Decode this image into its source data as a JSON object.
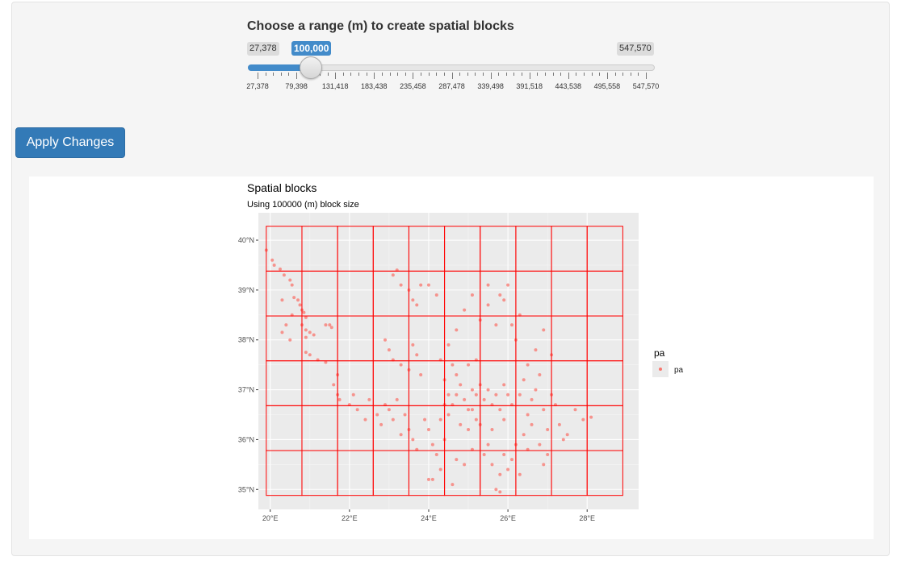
{
  "slider": {
    "label": "Choose a range (m) to create spatial blocks",
    "min_label": "27,378",
    "max_label": "547,570",
    "value_label": "100,000",
    "min": 27378,
    "max": 547570,
    "value": 100000,
    "accent_color": "#428bca",
    "grid_labels": [
      "27,378",
      "79,398",
      "131,418",
      "183,438",
      "235,458",
      "287,478",
      "339,498",
      "391,518",
      "443,538",
      "495,558",
      "547,570"
    ]
  },
  "apply_button": {
    "label": "Apply Changes",
    "color": "#337ab7"
  },
  "plot": {
    "title": "Spatial blocks",
    "subtitle": "Using 100000 (m) block size",
    "legend_title": "pa",
    "legend_label": "pa",
    "x_ticks": [
      "20°E",
      "22°E",
      "24°E",
      "26°E",
      "28°E"
    ],
    "y_ticks": [
      "35°N",
      "36°N",
      "37°N",
      "38°N",
      "39°N",
      "40°N"
    ],
    "point_color": "#f8766d",
    "block_color": "#ff0000",
    "panel_color": "#ebebeb"
  },
  "chart_data": {
    "type": "scatter",
    "title": "Spatial blocks",
    "subtitle": "Using 100000 (m) block size",
    "xlim": [
      19.7,
      29.3
    ],
    "ylim": [
      34.6,
      40.55
    ],
    "x_tick_values": [
      20,
      22,
      24,
      26,
      28
    ],
    "y_tick_values": [
      35,
      36,
      37,
      38,
      39,
      40
    ],
    "grid": true,
    "legend_placement": "right",
    "blocks": {
      "x_edges": [
        19.9,
        20.8,
        21.7,
        22.6,
        23.5,
        24.4,
        25.3,
        26.2,
        27.1,
        28.0,
        28.9
      ],
      "y_edges": [
        34.88,
        35.78,
        36.68,
        37.58,
        38.48,
        39.38,
        40.28
      ]
    },
    "series": [
      {
        "name": "pa",
        "points": [
          [
            19.9,
            39.8
          ],
          [
            20.05,
            39.6
          ],
          [
            20.1,
            39.5
          ],
          [
            20.25,
            39.42
          ],
          [
            20.35,
            39.3
          ],
          [
            20.5,
            39.2
          ],
          [
            20.55,
            39.1
          ],
          [
            20.3,
            38.8
          ],
          [
            20.6,
            38.85
          ],
          [
            20.7,
            38.8
          ],
          [
            20.75,
            38.7
          ],
          [
            20.8,
            38.6
          ],
          [
            20.85,
            38.55
          ],
          [
            20.55,
            38.5
          ],
          [
            20.9,
            38.45
          ],
          [
            20.4,
            38.3
          ],
          [
            20.8,
            38.3
          ],
          [
            20.9,
            38.2
          ],
          [
            20.3,
            38.15
          ],
          [
            21.0,
            38.15
          ],
          [
            21.1,
            38.1
          ],
          [
            20.5,
            38.0
          ],
          [
            20.9,
            38.05
          ],
          [
            21.4,
            38.3
          ],
          [
            21.5,
            38.3
          ],
          [
            21.55,
            38.25
          ],
          [
            20.9,
            37.75
          ],
          [
            21.0,
            37.7
          ],
          [
            21.2,
            37.6
          ],
          [
            21.4,
            37.55
          ],
          [
            21.7,
            37.3
          ],
          [
            21.6,
            37.1
          ],
          [
            21.7,
            36.9
          ],
          [
            21.75,
            36.8
          ],
          [
            22.0,
            36.7
          ],
          [
            22.1,
            36.9
          ],
          [
            22.2,
            36.6
          ],
          [
            22.4,
            36.4
          ],
          [
            22.5,
            36.8
          ],
          [
            22.7,
            36.5
          ],
          [
            22.8,
            36.3
          ],
          [
            22.9,
            36.7
          ],
          [
            23.0,
            36.6
          ],
          [
            23.1,
            36.4
          ],
          [
            23.2,
            36.8
          ],
          [
            23.0,
            37.8
          ],
          [
            22.9,
            38.0
          ],
          [
            23.1,
            37.6
          ],
          [
            23.3,
            37.5
          ],
          [
            23.6,
            37.9
          ],
          [
            23.7,
            37.7
          ],
          [
            23.5,
            37.4
          ],
          [
            23.8,
            37.3
          ],
          [
            23.1,
            39.3
          ],
          [
            23.2,
            39.4
          ],
          [
            23.3,
            39.1
          ],
          [
            23.5,
            39.0
          ],
          [
            23.6,
            38.8
          ],
          [
            23.8,
            39.1
          ],
          [
            23.7,
            38.7
          ],
          [
            24.0,
            39.1
          ],
          [
            24.2,
            38.9
          ],
          [
            23.4,
            36.5
          ],
          [
            23.5,
            36.2
          ],
          [
            23.6,
            36.0
          ],
          [
            23.7,
            35.8
          ],
          [
            23.3,
            36.1
          ],
          [
            23.9,
            36.4
          ],
          [
            24.0,
            36.2
          ],
          [
            24.1,
            35.9
          ],
          [
            24.0,
            35.2
          ],
          [
            24.1,
            35.2
          ],
          [
            24.3,
            35.4
          ],
          [
            24.2,
            35.7
          ],
          [
            24.4,
            36.0
          ],
          [
            24.5,
            36.5
          ],
          [
            24.6,
            36.7
          ],
          [
            24.7,
            36.9
          ],
          [
            24.8,
            37.1
          ],
          [
            24.9,
            36.8
          ],
          [
            25.0,
            36.6
          ],
          [
            25.1,
            37.0
          ],
          [
            25.2,
            36.9
          ],
          [
            25.3,
            37.1
          ],
          [
            25.4,
            36.8
          ],
          [
            25.5,
            37.0
          ],
          [
            25.6,
            36.7
          ],
          [
            25.7,
            36.9
          ],
          [
            25.8,
            36.6
          ],
          [
            25.9,
            37.1
          ],
          [
            26.0,
            36.9
          ],
          [
            25.2,
            36.4
          ],
          [
            25.0,
            36.2
          ],
          [
            25.4,
            35.7
          ],
          [
            25.6,
            35.5
          ],
          [
            25.8,
            35.3
          ],
          [
            25.7,
            35.0
          ],
          [
            25.8,
            34.95
          ],
          [
            26.0,
            35.4
          ],
          [
            26.1,
            35.6
          ],
          [
            26.2,
            35.9
          ],
          [
            26.3,
            35.3
          ],
          [
            26.4,
            36.1
          ],
          [
            26.5,
            36.5
          ],
          [
            26.6,
            36.8
          ],
          [
            26.7,
            37.0
          ],
          [
            26.8,
            37.3
          ],
          [
            26.9,
            36.6
          ],
          [
            27.0,
            36.2
          ],
          [
            27.1,
            36.9
          ],
          [
            27.2,
            36.7
          ],
          [
            27.3,
            36.3
          ],
          [
            27.4,
            36.0
          ],
          [
            27.5,
            36.1
          ],
          [
            27.7,
            36.6
          ],
          [
            27.9,
            36.4
          ],
          [
            28.1,
            36.45
          ],
          [
            24.3,
            37.6
          ],
          [
            24.5,
            37.9
          ],
          [
            24.7,
            38.2
          ],
          [
            24.9,
            38.6
          ],
          [
            25.1,
            38.9
          ],
          [
            25.3,
            38.4
          ],
          [
            25.5,
            38.7
          ],
          [
            25.7,
            38.3
          ],
          [
            25.9,
            38.8
          ],
          [
            26.0,
            39.1
          ],
          [
            26.1,
            38.3
          ],
          [
            26.2,
            38.0
          ],
          [
            26.3,
            38.5
          ],
          [
            26.5,
            37.5
          ],
          [
            26.7,
            37.8
          ],
          [
            26.9,
            38.2
          ],
          [
            27.1,
            37.7
          ],
          [
            25.5,
            39.1
          ],
          [
            25.8,
            38.9
          ],
          [
            25.2,
            37.6
          ],
          [
            25.0,
            37.5
          ],
          [
            24.7,
            37.3
          ],
          [
            24.6,
            37.5
          ],
          [
            24.4,
            37.2
          ],
          [
            24.5,
            36.9
          ],
          [
            24.4,
            36.7
          ],
          [
            24.3,
            36.4
          ],
          [
            24.8,
            36.3
          ],
          [
            25.1,
            36.6
          ],
          [
            25.3,
            36.3
          ],
          [
            25.6,
            36.2
          ],
          [
            25.9,
            36.4
          ],
          [
            26.1,
            36.7
          ],
          [
            26.3,
            36.9
          ],
          [
            26.4,
            37.2
          ],
          [
            26.6,
            36.3
          ],
          [
            26.8,
            35.9
          ],
          [
            27.0,
            35.7
          ],
          [
            26.9,
            35.5
          ],
          [
            26.5,
            35.8
          ],
          [
            25.9,
            35.7
          ],
          [
            25.5,
            35.9
          ],
          [
            25.1,
            35.8
          ],
          [
            24.9,
            35.5
          ],
          [
            24.7,
            35.6
          ],
          [
            24.6,
            35.1
          ]
        ]
      }
    ]
  }
}
